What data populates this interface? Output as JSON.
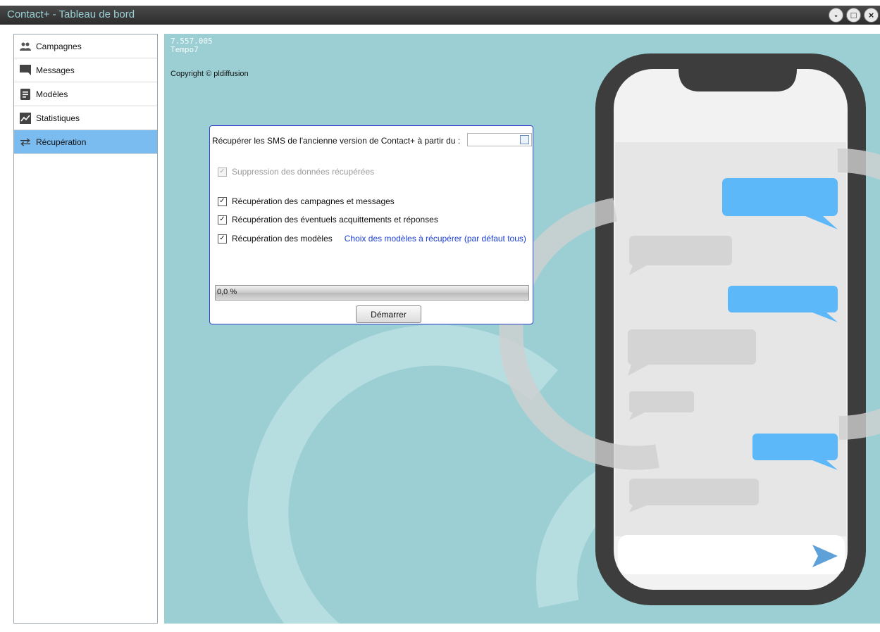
{
  "window": {
    "title": "Contact+ - Tableau de bord",
    "controls": {
      "minimize": "-",
      "maximize": "□",
      "close": "×"
    }
  },
  "sidebar": {
    "items": [
      {
        "label": "Campagnes",
        "icon": "people-icon",
        "active": false
      },
      {
        "label": "Messages",
        "icon": "chat-icon",
        "active": false
      },
      {
        "label": "Modèles",
        "icon": "document-icon",
        "active": false
      },
      {
        "label": "Statistiques",
        "icon": "chart-icon",
        "active": false
      },
      {
        "label": "Récupération",
        "icon": "transfer-icon",
        "active": true
      }
    ]
  },
  "header": {
    "version": "7.557.005",
    "build": "Tempo7",
    "copyright": "Copyright © pldiffusion"
  },
  "recovery": {
    "from_label": "Récupérer les SMS de l'ancienne version de Contact+ à partir du :",
    "date_value": "",
    "options": [
      {
        "label": "Suppression des données récupérées",
        "checked": true,
        "enabled": false
      },
      {
        "label": "Récupération des campagnes et messages",
        "checked": true,
        "enabled": true
      },
      {
        "label": "Récupération des éventuels acquittements et réponses",
        "checked": true,
        "enabled": true
      },
      {
        "label": "Récupération des modèles",
        "checked": true,
        "enabled": true
      }
    ],
    "templates_link": "Choix des modèles à récupérer (par défaut tous)",
    "progress_text": "0,0 %",
    "progress_fraction": 0.0,
    "start_button": "Démarrer"
  },
  "colors": {
    "accent": "#7bbcf0",
    "background": "#9ccfd4",
    "bubble_sent": "#5cb8f8",
    "bubble_received": "#d4d4d4",
    "link": "#1a3fd6"
  }
}
